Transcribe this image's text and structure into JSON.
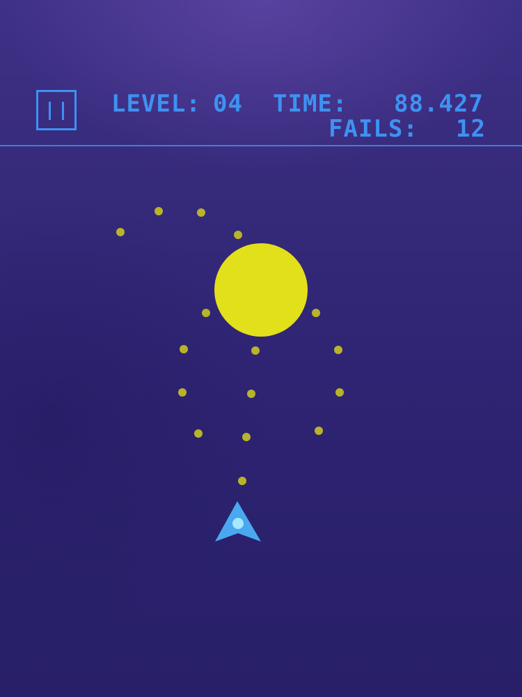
{
  "hud": {
    "level_label": "LEVEL:",
    "level_value": "04",
    "time_label": "TIME:",
    "time_value": "88.427",
    "fails_label": "FAILS:",
    "fails_value": "12"
  },
  "pause_button": {
    "icon": "pause-icon"
  },
  "colors": {
    "background": "#2e2470",
    "hud_text": "#3e92f2",
    "sun": "#e2e01a",
    "dots": "#b8b42a",
    "player": "#4aa8f0",
    "player_core": "#a6e8ff"
  }
}
